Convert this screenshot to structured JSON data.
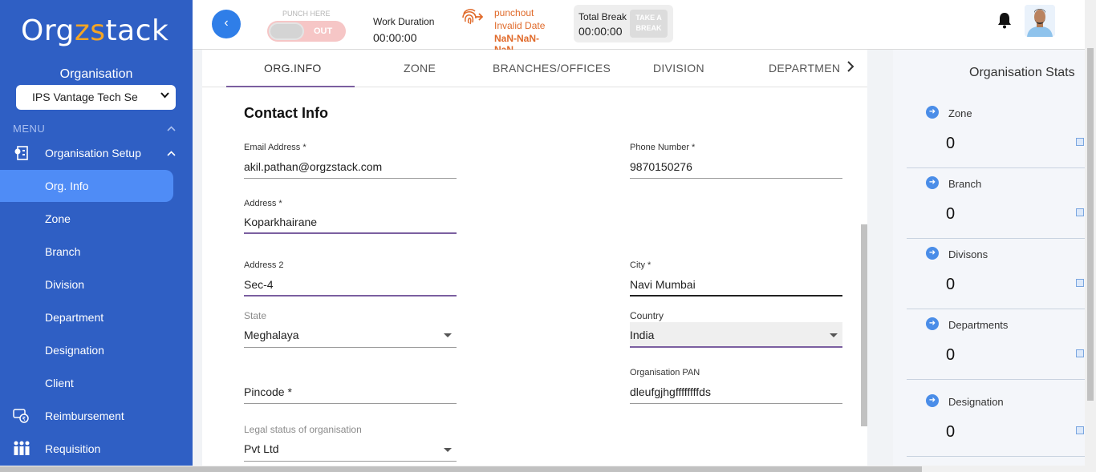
{
  "sidebar": {
    "logo": {
      "part1": "Org",
      "part2": "zs",
      "part3": "tack"
    },
    "org_label": "Organisation",
    "org_select_value": "IPS Vantage Tech Se",
    "menu_label": "MENU",
    "items": [
      {
        "label": "Organisation Setup",
        "icon": "org-setup-icon"
      },
      {
        "label": "Org. Info"
      },
      {
        "label": "Zone"
      },
      {
        "label": "Branch"
      },
      {
        "label": "Division"
      },
      {
        "label": "Department"
      },
      {
        "label": "Designation"
      },
      {
        "label": "Client"
      },
      {
        "label": "Reimbursement",
        "icon": "reimbursement-icon"
      },
      {
        "label": "Requisition",
        "icon": "requisition-icon"
      }
    ]
  },
  "header": {
    "back_label": "‹",
    "punch_title": "PUNCH HERE",
    "punch_state": "OUT",
    "work_duration_label": "Work Duration",
    "work_duration_value": "00:00:00",
    "punchout_label": "punchout",
    "punchout_date": "Invalid Date",
    "punchout_time": "NaN-NaN-NaN",
    "total_break_label": "Total Break",
    "total_break_value": "00:00:00",
    "take_break_label": "TAKE A BREAK"
  },
  "tabs": [
    {
      "label": "ORG.INFO",
      "active": true
    },
    {
      "label": "ZONE"
    },
    {
      "label": "BRANCHES/OFFICES"
    },
    {
      "label": "DIVISION"
    },
    {
      "label": "DEPARTMEN"
    }
  ],
  "form": {
    "title": "Contact Info",
    "email_label": "Email Address *",
    "email_value": "akil.pathan@orgzstack.com",
    "phone_label": "Phone Number *",
    "phone_value": "9870150276",
    "address_label": "Address *",
    "address_value": "Koparkhairane",
    "address2_label": "Address 2",
    "address2_value": "Sec-4",
    "city_label": "City *",
    "city_value": "Navi Mumbai",
    "state_label": "State",
    "state_value": "Meghalaya",
    "country_label": "Country",
    "country_value": "India",
    "pincode_placeholder": "Pincode *",
    "pan_label": "Organisation PAN",
    "pan_value": "dleufgjhgffffffffds",
    "legal_label": "Legal status of organisation",
    "legal_value": "Pvt Ltd"
  },
  "stats": {
    "title": "Organisation Stats",
    "items": [
      {
        "name": "Zone",
        "value": "0"
      },
      {
        "name": "Branch",
        "value": "0"
      },
      {
        "name": "Divisons",
        "value": "0"
      },
      {
        "name": "Departments",
        "value": "0"
      },
      {
        "name": "Designation",
        "value": "0"
      }
    ]
  },
  "colors": {
    "sidebar": "#2f5fc4",
    "active_item": "#4f8cf6",
    "accent": "#7b5fa0",
    "punch_orange": "#e06a2a"
  }
}
